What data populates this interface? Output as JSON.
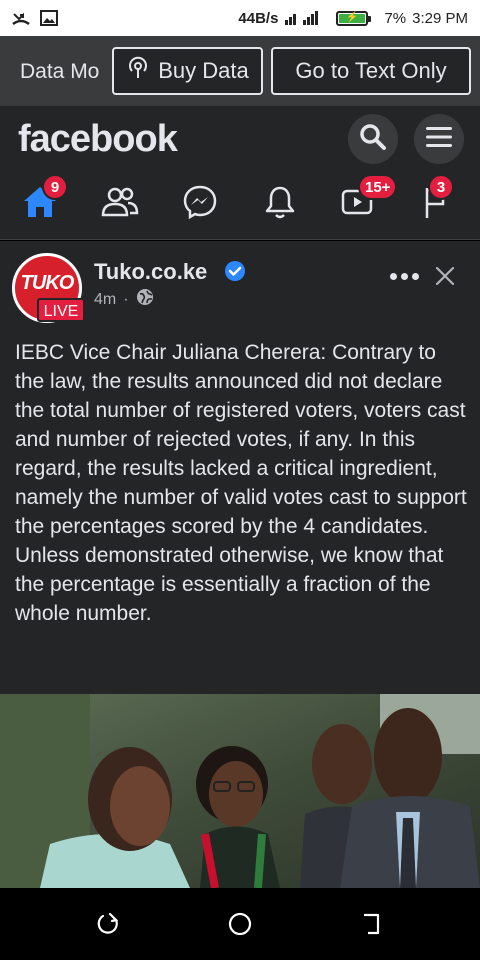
{
  "status_bar": {
    "net_speed": "44B/s",
    "battery_percent": "7%",
    "time": "3:29 PM",
    "icons": [
      "missed-call-icon",
      "gallery-icon",
      "signal-icon",
      "battery-charging-icon"
    ]
  },
  "data_bar": {
    "mode_label": "Data Mo",
    "buy_data_label": "Buy Data",
    "text_only_label": "Go to Text Only"
  },
  "header": {
    "logo": "facebook",
    "nav": {
      "home_badge": "9",
      "video_badge": "15+",
      "flag_badge": "3"
    }
  },
  "post": {
    "page_name": "Tuko.co.ke",
    "time_ago": "4m",
    "separator": "·",
    "avatar_logo": "TUKO",
    "avatar_live": "LIVE",
    "text": "IEBC Vice Chair Juliana Cherera: Contrary to the law, the results announced did not declare the total number of registered voters, voters cast and number of rejected votes, if any. In this regard, the results lacked a critical ingredient, namely the number of valid votes cast to support the percentages scored by the 4 candidates. Unless demonstrated otherwise, we know that the percentage is essentially a fraction of the whole number."
  },
  "colors": {
    "accent": "#2d88ff",
    "badge": "#e41e3f",
    "surface": "#242526"
  }
}
